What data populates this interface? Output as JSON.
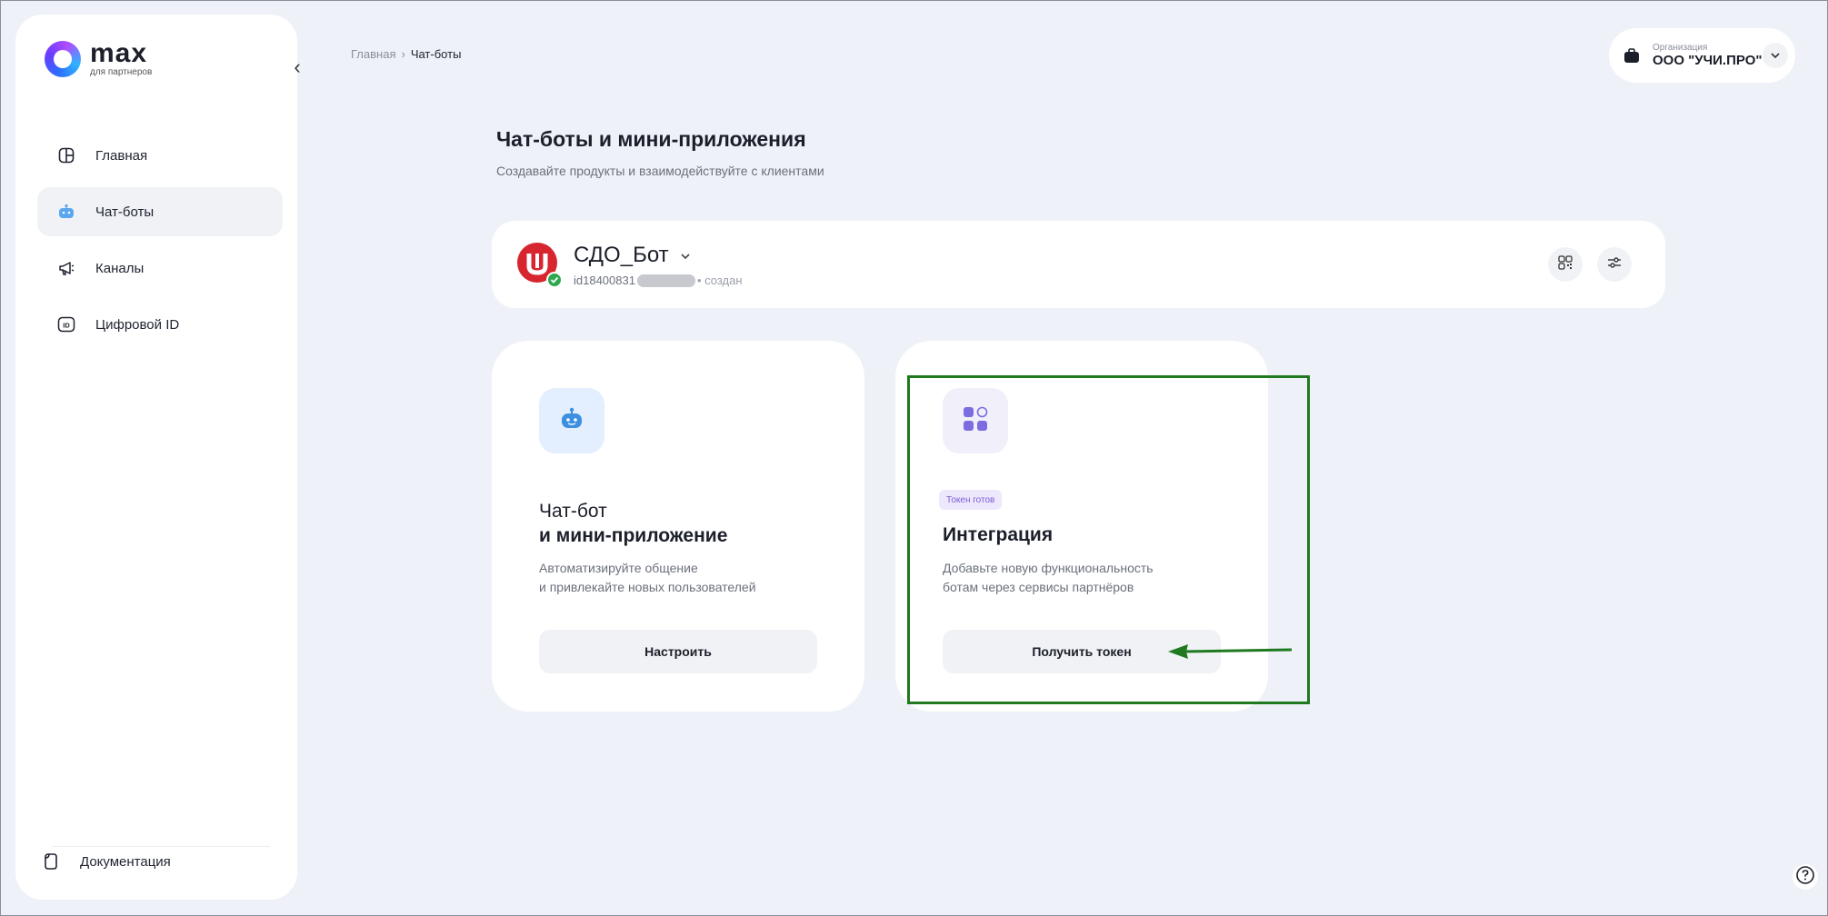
{
  "logo": {
    "name": "max",
    "subtitle": "для партнеров"
  },
  "sidebar": {
    "items": [
      {
        "label": "Главная",
        "icon": "home-icon"
      },
      {
        "label": "Чат-боты",
        "icon": "robot-icon",
        "active": true
      },
      {
        "label": "Каналы",
        "icon": "megaphone-icon"
      },
      {
        "label": "Цифровой ID",
        "icon": "id-icon"
      }
    ],
    "docs_label": "Документация"
  },
  "breadcrumb": {
    "home": "Главная",
    "separator": "›",
    "current": "Чат-боты"
  },
  "org": {
    "label": "Организация",
    "name": "ООО \"УЧИ.ПРО\""
  },
  "main": {
    "title": "Чат-боты и мини-приложения",
    "subtitle": "Создавайте продукты и взаимодействуйте с клиентами"
  },
  "bot": {
    "name": "СДО_Бот",
    "id_prefix": "id18400831",
    "status": "• создан"
  },
  "cards": {
    "chatbot": {
      "title_line1": "Чат-бот",
      "title_line2": "и мини-приложение",
      "desc_line1": "Автоматизируйте общение",
      "desc_line2": "и привлекайте новых пользователей",
      "button": "Настроить"
    },
    "integration": {
      "badge": "Токен готов",
      "title": "Интеграция",
      "desc_line1": "Добавьте новую функциональность",
      "desc_line2": "ботам через сервисы партнёров",
      "button": "Получить токен"
    }
  },
  "colors": {
    "accent_highlight": "#1f7a1f",
    "brand_red": "#d7262f",
    "badge_text": "#7c5bd6"
  }
}
